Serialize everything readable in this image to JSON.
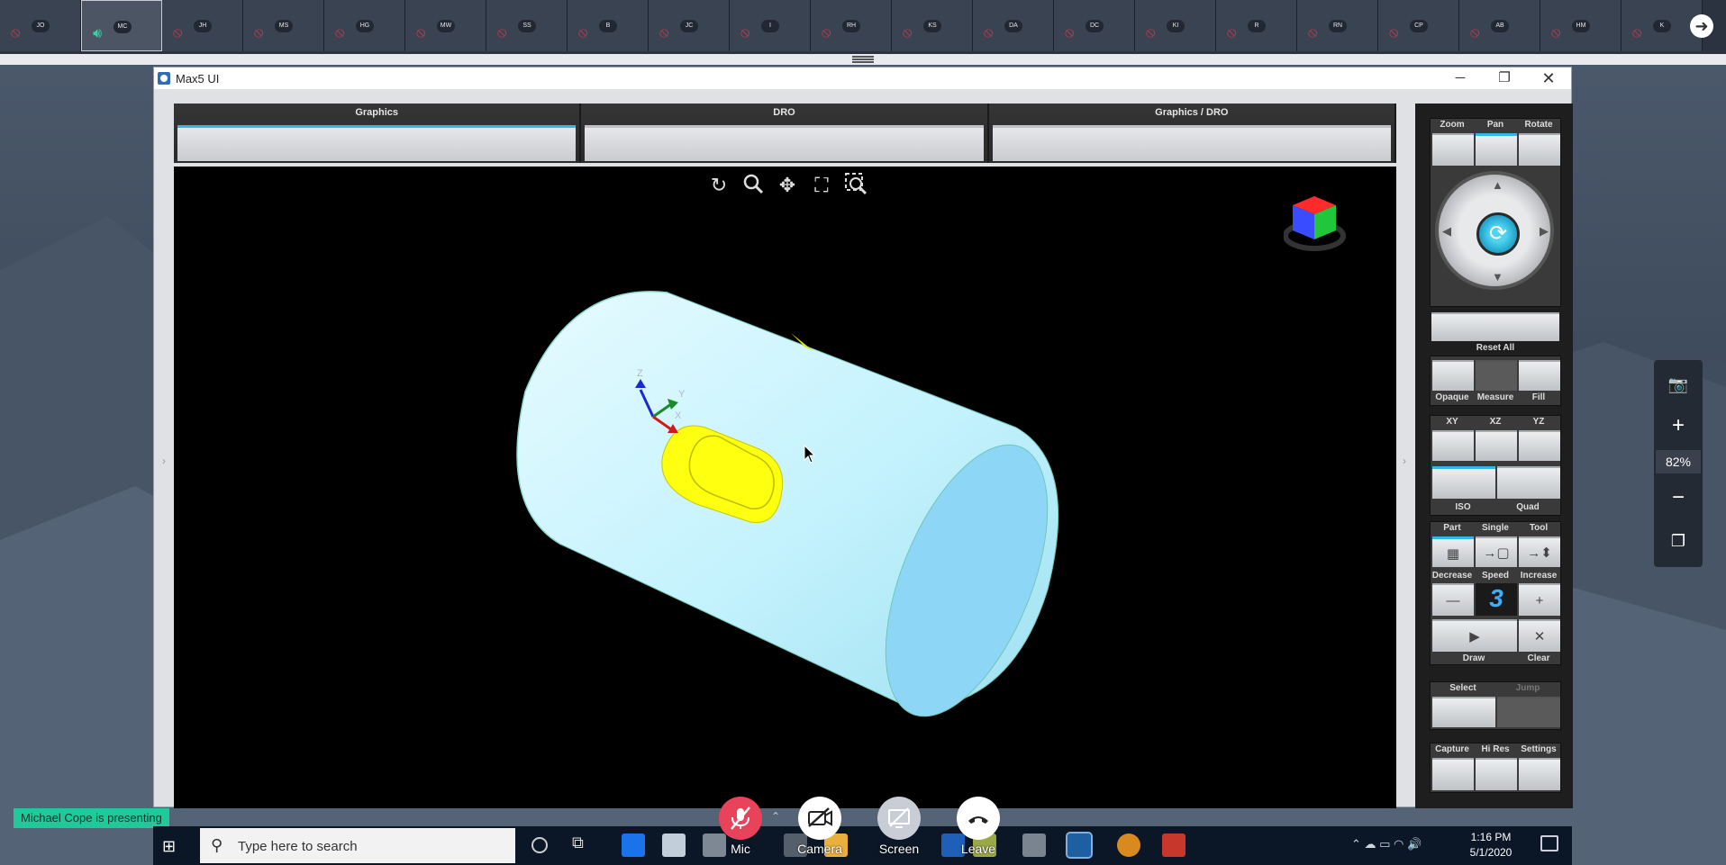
{
  "participants": [
    {
      "initials": "JO",
      "mic": "muted"
    },
    {
      "initials": "MC",
      "mic": "speaking",
      "active": true
    },
    {
      "initials": "JH",
      "mic": "muted"
    },
    {
      "initials": "MS",
      "mic": "muted"
    },
    {
      "initials": "HG",
      "mic": "muted"
    },
    {
      "initials": "MW",
      "mic": "muted"
    },
    {
      "initials": "SS",
      "mic": "muted"
    },
    {
      "initials": "B",
      "mic": "muted"
    },
    {
      "initials": "JC",
      "mic": "muted"
    },
    {
      "initials": "I",
      "mic": "muted"
    },
    {
      "initials": "RH",
      "mic": "muted"
    },
    {
      "initials": "KS",
      "mic": "muted"
    },
    {
      "initials": "DA",
      "mic": "muted"
    },
    {
      "initials": "DC",
      "mic": "muted"
    },
    {
      "initials": "KI",
      "mic": "muted"
    },
    {
      "initials": "R",
      "mic": "muted"
    },
    {
      "initials": "RN",
      "mic": "muted"
    },
    {
      "initials": "CP",
      "mic": "muted"
    },
    {
      "initials": "AB",
      "mic": "muted"
    },
    {
      "initials": "HM",
      "mic": "muted"
    },
    {
      "initials": "K",
      "mic": "muted"
    }
  ],
  "window": {
    "title": "Max5 UI"
  },
  "tabs": [
    "Graphics",
    "DRO",
    "Graphics / DRO"
  ],
  "selected_tab": "Graphics",
  "axis_labels": {
    "z": "Z",
    "y": "Y",
    "x": "X"
  },
  "panel": {
    "view": {
      "zoom": "Zoom",
      "pan": "Pan",
      "rotate": "Rotate",
      "selected": "Pan"
    },
    "reset_all": "Reset All",
    "display": {
      "opaque": "Opaque",
      "measure": "Measure",
      "fill": "Fill"
    },
    "planes": {
      "xy": "XY",
      "xz": "XZ",
      "yz": "YZ",
      "iso": "ISO",
      "quad": "Quad"
    },
    "mode": {
      "part": "Part",
      "single": "Single",
      "tool": "Tool"
    },
    "speed": {
      "decrease": "Decrease",
      "label": "Speed",
      "increase": "Increase",
      "value": "3"
    },
    "draw": "Draw",
    "clear": "Clear",
    "select": "Select",
    "jump": "Jump",
    "bottom": {
      "capture": "Capture",
      "hires": "Hi Res",
      "settings": "Settings"
    }
  },
  "zoom": {
    "percent": "82%"
  },
  "presenting": "Michael Cope is presenting",
  "call": {
    "mic": "Mic",
    "camera": "Camera",
    "screen": "Screen",
    "leave": "Leave"
  },
  "taskbar": {
    "search_placeholder": "Type here to search",
    "time": "1:16 PM",
    "date": "5/1/2020"
  },
  "colors": {
    "accent": "#32b6e8",
    "muted": "#e0344d",
    "speaking": "#39d1a6",
    "presenting": "#1fc99a",
    "part": "#bff3ff",
    "slot": "#f5f500"
  }
}
